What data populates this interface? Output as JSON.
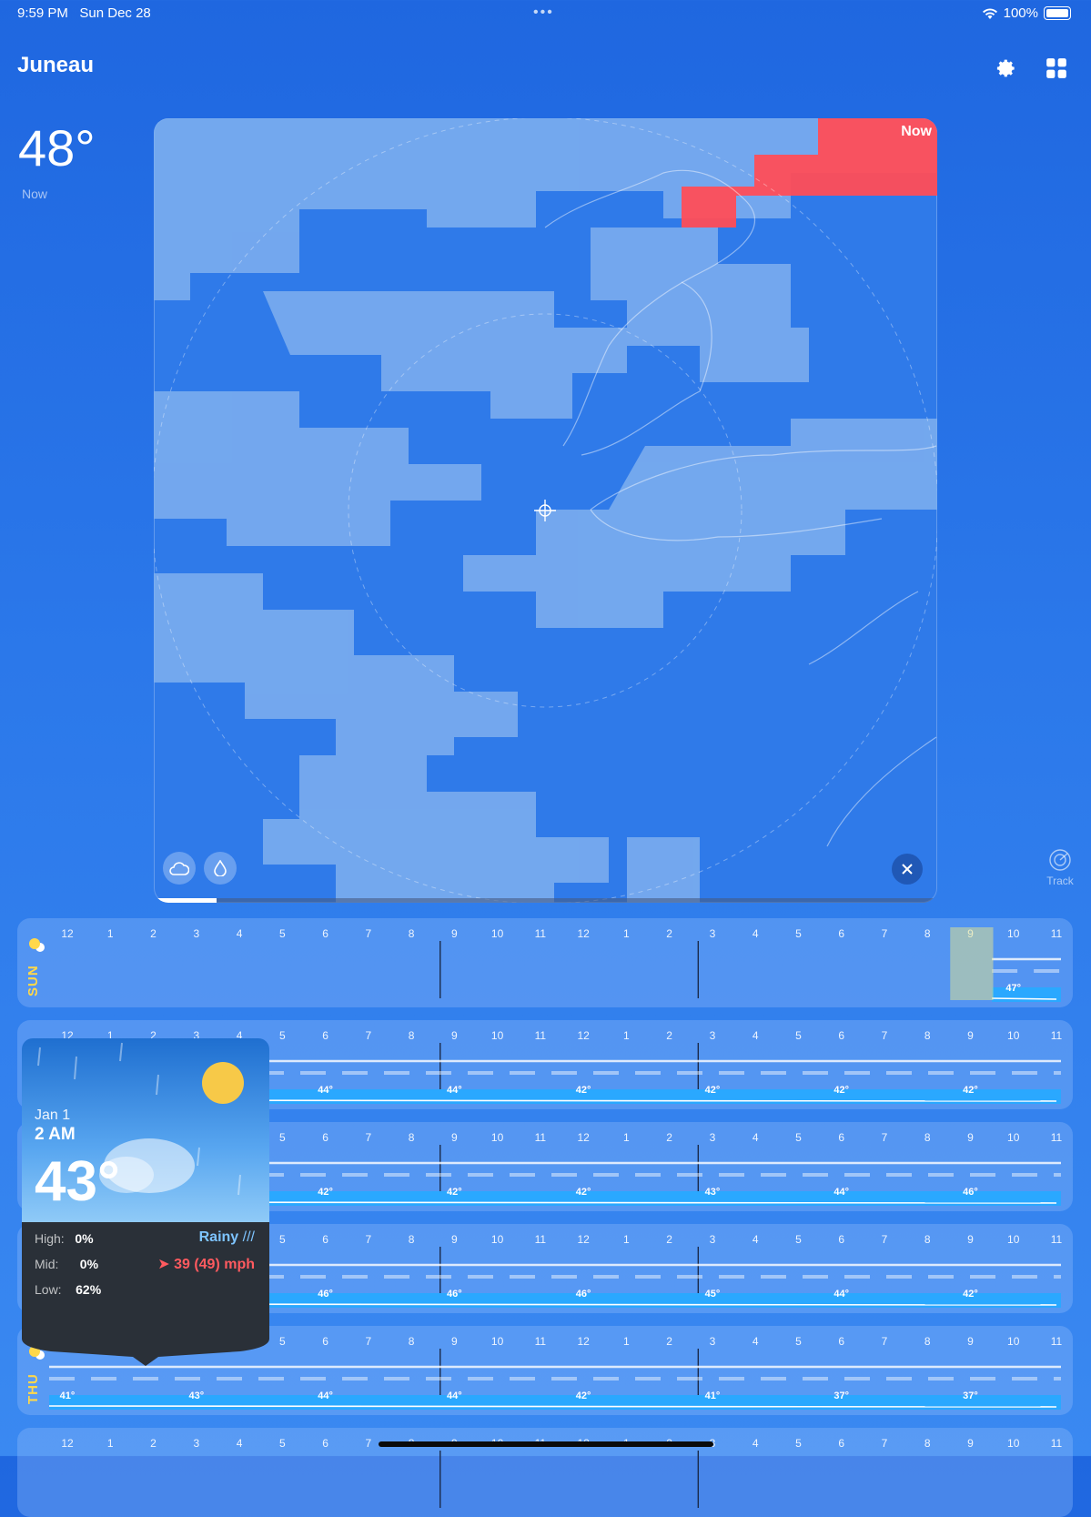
{
  "status": {
    "time": "9:59 PM",
    "date": "Sun Dec 28",
    "battery": "100%"
  },
  "header": {
    "city": "Juneau",
    "settings_icon": "gear-icon",
    "layout_icon": "grid-icon"
  },
  "current": {
    "temp": "48°",
    "label": "Now"
  },
  "radar": {
    "time_label": "Now",
    "progress": 0.08,
    "track_label": "Track"
  },
  "hours": [
    "12",
    "1",
    "2",
    "3",
    "4",
    "5",
    "6",
    "7",
    "8",
    "9",
    "10",
    "11",
    "12",
    "1",
    "2",
    "3",
    "4",
    "5",
    "6",
    "7",
    "8",
    "9",
    "10",
    "11"
  ],
  "days": [
    {
      "label": "SUN",
      "temps": [
        {
          "h": 22,
          "v": "47°"
        }
      ]
    },
    {
      "label": "",
      "temps": [
        {
          "h": 6,
          "v": "44°"
        },
        {
          "h": 9,
          "v": "44°"
        },
        {
          "h": 12,
          "v": "42°"
        },
        {
          "h": 15,
          "v": "42°"
        },
        {
          "h": 18,
          "v": "42°"
        },
        {
          "h": 21,
          "v": "42°"
        }
      ]
    },
    {
      "label": "",
      "temps": [
        {
          "h": 6,
          "v": "42°"
        },
        {
          "h": 9,
          "v": "42°"
        },
        {
          "h": 12,
          "v": "42°"
        },
        {
          "h": 15,
          "v": "43°"
        },
        {
          "h": 18,
          "v": "44°"
        },
        {
          "h": 21,
          "v": "46°"
        }
      ]
    },
    {
      "label": "",
      "temps": [
        {
          "h": 6,
          "v": "46°"
        },
        {
          "h": 9,
          "v": "46°"
        },
        {
          "h": 12,
          "v": "46°"
        },
        {
          "h": 15,
          "v": "45°"
        },
        {
          "h": 18,
          "v": "44°"
        },
        {
          "h": 21,
          "v": "42°"
        }
      ]
    },
    {
      "label": "THU",
      "temps": [
        {
          "h": 0,
          "v": "41°"
        },
        {
          "h": 3,
          "v": "43°"
        },
        {
          "h": 6,
          "v": "44°"
        },
        {
          "h": 9,
          "v": "44°"
        },
        {
          "h": 12,
          "v": "42°"
        },
        {
          "h": 15,
          "v": "41°"
        },
        {
          "h": 18,
          "v": "37°"
        },
        {
          "h": 21,
          "v": "37°"
        }
      ]
    },
    {
      "label": "",
      "temps": []
    }
  ],
  "popup": {
    "date": "Jan 1",
    "time": "2 AM",
    "temp": "43°",
    "high_label": "High:",
    "high": "0%",
    "mid_label": "Mid:",
    "mid": "0%",
    "low_label": "Low:",
    "low": "62%",
    "condition": "Rainy",
    "wind": "39 (49) mph"
  }
}
